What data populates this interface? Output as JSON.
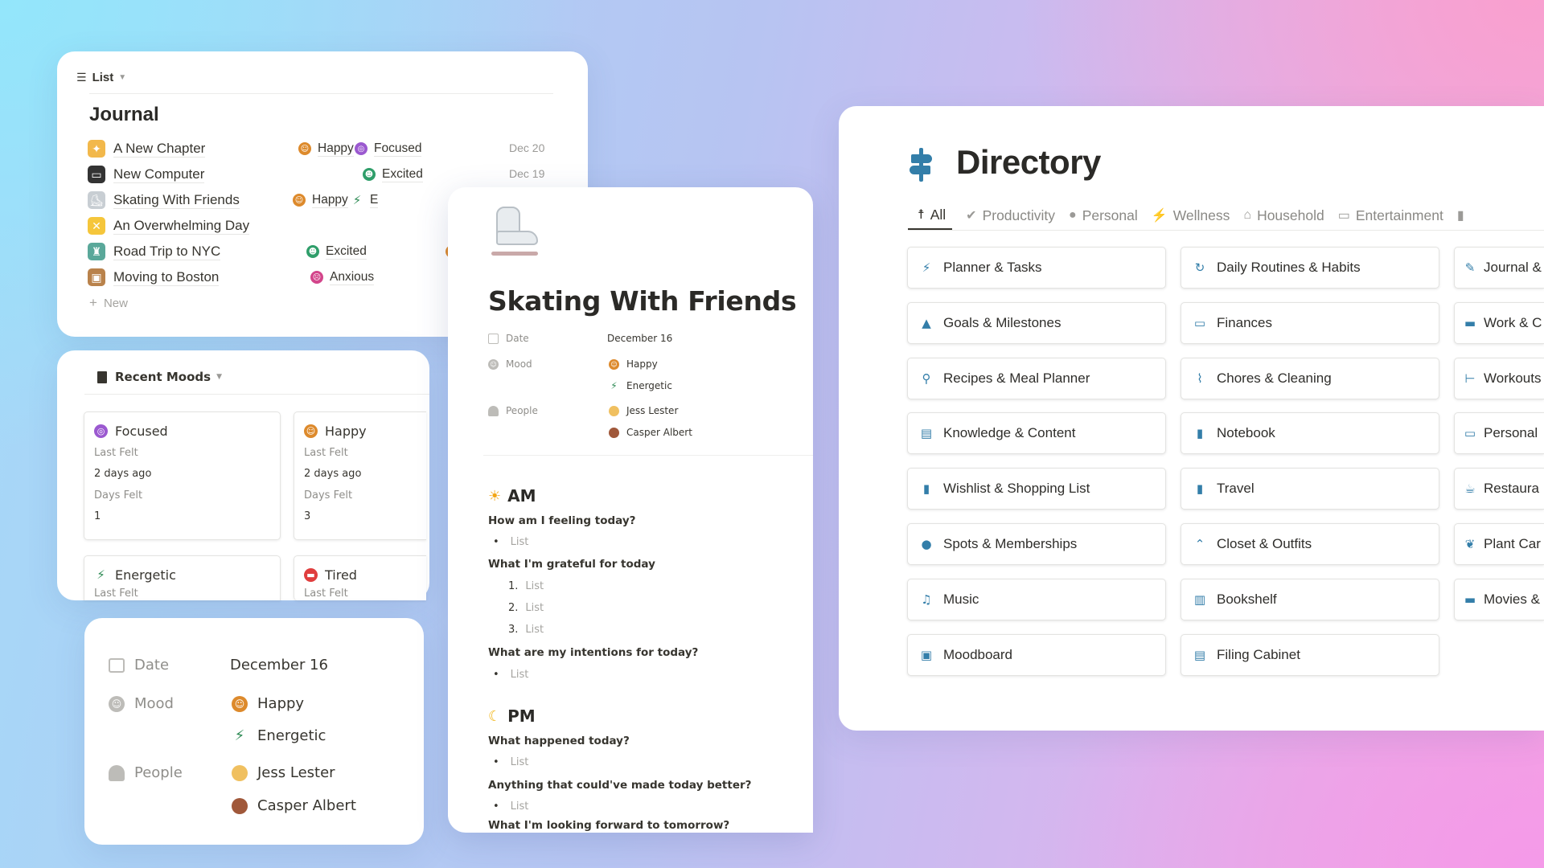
{
  "colors": {
    "accent_blue": "#337ea9",
    "happy": "#dd8a2c",
    "focused": "#9b59d0",
    "excited": "#2f9e6a",
    "energetic": "#2d8a54",
    "anxious": "#d3458b",
    "tired": "#e03e3e"
  },
  "journal": {
    "view_label": "List",
    "title": "Journal",
    "new_label": "New",
    "rows": [
      {
        "icon": "party-popper",
        "title": "A New Chapter",
        "tags": [
          {
            "icon": "happy",
            "label": "Happy"
          },
          {
            "icon": "focused",
            "label": "Focused"
          }
        ],
        "date": "Dec 20"
      },
      {
        "icon": "laptop",
        "title": "New Computer",
        "tags": [
          {
            "icon": "excited",
            "label": "Excited"
          }
        ],
        "date": "Dec 19"
      },
      {
        "icon": "ice-skate",
        "title": "Skating With Friends",
        "tags": [
          {
            "icon": "happy",
            "label": "Happy"
          },
          {
            "icon": "energetic",
            "label": "E"
          }
        ],
        "date": ""
      },
      {
        "icon": "dizzy-face",
        "title": "An Overwhelming Day",
        "tags": [],
        "date": ""
      },
      {
        "icon": "statue-of-liberty",
        "title": "Road Trip to NYC",
        "tags": [
          {
            "icon": "excited",
            "label": "Excited"
          },
          {
            "icon": "happy",
            "label": ""
          }
        ],
        "date": ""
      },
      {
        "icon": "package",
        "title": "Moving to Boston",
        "tags": [
          {
            "icon": "anxious",
            "label": "Anxious"
          }
        ],
        "date": ""
      }
    ]
  },
  "moods": {
    "title": "Recent Moods",
    "cards": [
      {
        "icon": "focused",
        "name": "Focused",
        "last_felt_label": "Last Felt",
        "last_felt": "2 days ago",
        "days_felt_label": "Days Felt",
        "days_felt": "1"
      },
      {
        "icon": "happy",
        "name": "Happy",
        "last_felt_label": "Last Felt",
        "last_felt": "2 days ago",
        "days_felt_label": "Days Felt",
        "days_felt": "3"
      },
      {
        "icon": "energetic",
        "name": "Energetic",
        "last_felt_label": "Last Felt"
      },
      {
        "icon": "tired",
        "name": "Tired",
        "last_felt_label": "Last Felt"
      }
    ]
  },
  "props": {
    "date_label": "Date",
    "date": "December 16",
    "mood_label": "Mood",
    "moods": [
      "Happy",
      "Energetic"
    ],
    "people_label": "People",
    "people": [
      "Jess Lester",
      "Casper Albert"
    ]
  },
  "page": {
    "title": "Skating With Friends",
    "date_label": "Date",
    "date": "December 16",
    "mood_label": "Mood",
    "moods": [
      "Happy",
      "Energetic"
    ],
    "people_label": "People",
    "people": [
      "Jess Lester",
      "Casper Albert"
    ],
    "am": {
      "heading": "AM",
      "q1": "How am I feeling today?",
      "q2": "What I'm grateful for today",
      "q3": "What are my intentions for today?"
    },
    "pm": {
      "heading": "PM",
      "q1": "What happened today?",
      "q2": "Anything that could've made today better?",
      "q3": "What I'm looking forward to tomorrow?"
    },
    "list_placeholder": "List",
    "numbers": [
      "1.",
      "2.",
      "3."
    ]
  },
  "directory": {
    "title": "Directory",
    "tabs": [
      {
        "icon": "person-icon",
        "label": "All",
        "active": true
      },
      {
        "icon": "check-circle-icon",
        "label": "Productivity"
      },
      {
        "icon": "user-icon",
        "label": "Personal"
      },
      {
        "icon": "bolt-icon",
        "label": "Wellness"
      },
      {
        "icon": "home-icon",
        "label": "Household"
      },
      {
        "icon": "tv-icon",
        "label": "Entertainment"
      },
      {
        "icon": "luggage-icon",
        "label": ""
      }
    ],
    "columns": [
      [
        {
          "icon": "bolt",
          "label": "Planner & Tasks"
        },
        {
          "icon": "mountain",
          "label": "Goals & Milestones"
        },
        {
          "icon": "search",
          "label": "Recipes & Meal Planner"
        },
        {
          "icon": "browser",
          "label": "Knowledge & Content"
        },
        {
          "icon": "lock",
          "label": "Wishlist & Shopping List"
        },
        {
          "icon": "pin",
          "label": "Spots & Memberships"
        },
        {
          "icon": "music",
          "label": "Music"
        },
        {
          "icon": "picture",
          "label": "Moodboard"
        }
      ],
      [
        {
          "icon": "refresh",
          "label": "Daily Routines & Habits"
        },
        {
          "icon": "money",
          "label": "Finances"
        },
        {
          "icon": "broom",
          "label": "Chores & Cleaning"
        },
        {
          "icon": "book",
          "label": "Notebook"
        },
        {
          "icon": "luggage",
          "label": "Travel"
        },
        {
          "icon": "hanger",
          "label": "Closet & Outfits"
        },
        {
          "icon": "books",
          "label": "Bookshelf"
        },
        {
          "icon": "cabinet",
          "label": "Filing Cabinet"
        }
      ],
      [
        {
          "icon": "edit",
          "label": "Journal &"
        },
        {
          "icon": "briefcase",
          "label": "Work & C"
        },
        {
          "icon": "dumbbell",
          "label": "Workouts"
        },
        {
          "icon": "id-card",
          "label": "Personal"
        },
        {
          "icon": "cup",
          "label": "Restaura"
        },
        {
          "icon": "leaf",
          "label": "Plant Car"
        },
        {
          "icon": "monitor",
          "label": "Movies &"
        }
      ]
    ]
  }
}
